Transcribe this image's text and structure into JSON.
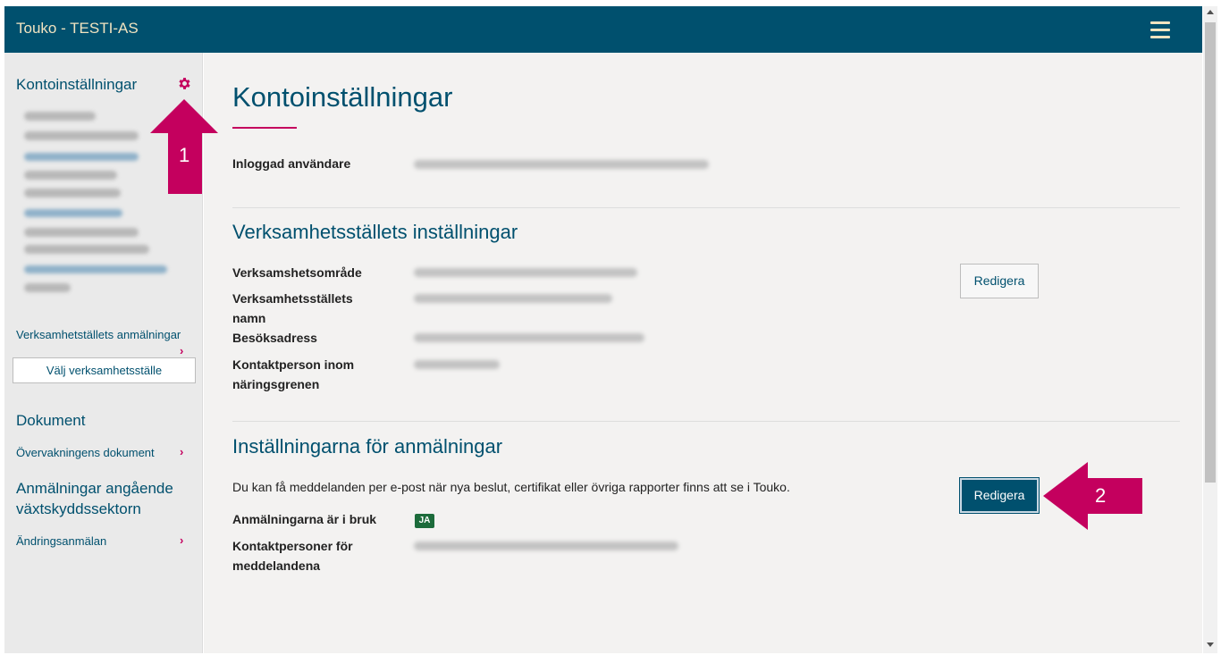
{
  "header": {
    "title": "Touko - TESTI-AS",
    "menu_icon": "hamburger-menu-icon",
    "colors": {
      "background": "#00506e",
      "title": "#f1e3c0"
    }
  },
  "sidebar": {
    "account_heading": "Kontoinställningar",
    "settings_icon": "gear-icon",
    "site_notifications_link": "Verksamhetställets anmälningar",
    "choose_site_button": "Välj verksamhetsställe",
    "documents_heading": "Dokument",
    "monitoring_documents_link": "Övervakningens dokument",
    "plant_health_heading": "Anmälningar angående växtskyddssektorn",
    "change_notification_link": "Ändringsanmälan",
    "chevron": "›"
  },
  "main": {
    "title": "Kontoinställningar",
    "logged_in_label": "Inloggad användare",
    "site_settings_heading": "Verksamhetsställets inställningar",
    "site_fields": [
      {
        "label": "Verksamshetsområde"
      },
      {
        "label": "Verksamhetsställets namn"
      },
      {
        "label": "Besöksadress"
      },
      {
        "label": "Kontaktperson inom näringsgrenen"
      }
    ],
    "edit_site_button": "Redigera",
    "notification_settings_heading": "Inställningarna för anmälningar",
    "notification_info": "Du kan få meddelanden per e-post när nya beslut, certifikat eller övriga rapporter finns att se i Touko.",
    "notifications_in_use_label": "Anmälningarna är i bruk",
    "notifications_in_use_value": "JA",
    "contact_persons_label": "Kontaktpersoner för meddelandena",
    "edit_notifications_button": "Redigera"
  },
  "annotations": [
    {
      "number": "1",
      "direction": "up"
    },
    {
      "number": "2",
      "direction": "left"
    }
  ],
  "colors": {
    "accent": "#c4005e",
    "link": "#00506e",
    "badge": "#1c6b3b"
  }
}
